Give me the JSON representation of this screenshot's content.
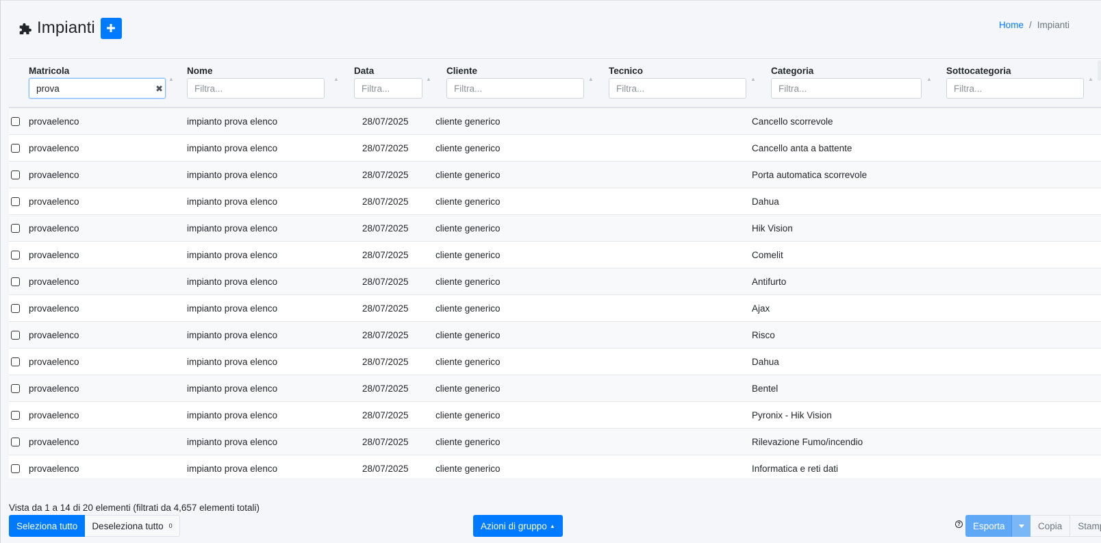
{
  "header": {
    "title": "Impianti",
    "breadcrumb": {
      "home": "Home",
      "separator": "/",
      "current": "Impianti"
    }
  },
  "table": {
    "columns": [
      {
        "key": "matricola",
        "label": "Matricola",
        "filter_value": "prova",
        "placeholder": "Filtra..."
      },
      {
        "key": "nome",
        "label": "Nome",
        "filter_value": "",
        "placeholder": "Filtra..."
      },
      {
        "key": "data",
        "label": "Data",
        "filter_value": "",
        "placeholder": "Filtra..."
      },
      {
        "key": "cliente",
        "label": "Cliente",
        "filter_value": "",
        "placeholder": "Filtra..."
      },
      {
        "key": "tecnico",
        "label": "Tecnico",
        "filter_value": "",
        "placeholder": "Filtra..."
      },
      {
        "key": "categoria",
        "label": "Categoria",
        "filter_value": "",
        "placeholder": "Filtra..."
      },
      {
        "key": "sottocategoria",
        "label": "Sottocategoria",
        "filter_value": "",
        "placeholder": "Filtra..."
      }
    ],
    "rows": [
      {
        "matricola": "provaelenco",
        "nome": "impianto prova elenco",
        "data": "28/07/2025",
        "cliente": "cliente generico",
        "tecnico": "",
        "categoria": "Cancello scorrevole",
        "sottocategoria": ""
      },
      {
        "matricola": "provaelenco",
        "nome": "impianto prova elenco",
        "data": "28/07/2025",
        "cliente": "cliente generico",
        "tecnico": "",
        "categoria": "Cancello anta a battente",
        "sottocategoria": ""
      },
      {
        "matricola": "provaelenco",
        "nome": "impianto prova elenco",
        "data": "28/07/2025",
        "cliente": "cliente generico",
        "tecnico": "",
        "categoria": "Porta automatica scorrevole",
        "sottocategoria": ""
      },
      {
        "matricola": "provaelenco",
        "nome": "impianto prova elenco",
        "data": "28/07/2025",
        "cliente": "cliente generico",
        "tecnico": "",
        "categoria": "Dahua",
        "sottocategoria": ""
      },
      {
        "matricola": "provaelenco",
        "nome": "impianto prova elenco",
        "data": "28/07/2025",
        "cliente": "cliente generico",
        "tecnico": "",
        "categoria": "Hik Vision",
        "sottocategoria": ""
      },
      {
        "matricola": "provaelenco",
        "nome": "impianto prova elenco",
        "data": "28/07/2025",
        "cliente": "cliente generico",
        "tecnico": "",
        "categoria": "Comelit",
        "sottocategoria": ""
      },
      {
        "matricola": "provaelenco",
        "nome": "impianto prova elenco",
        "data": "28/07/2025",
        "cliente": "cliente generico",
        "tecnico": "",
        "categoria": "Antifurto",
        "sottocategoria": ""
      },
      {
        "matricola": "provaelenco",
        "nome": "impianto prova elenco",
        "data": "28/07/2025",
        "cliente": "cliente generico",
        "tecnico": "",
        "categoria": "Ajax",
        "sottocategoria": ""
      },
      {
        "matricola": "provaelenco",
        "nome": "impianto prova elenco",
        "data": "28/07/2025",
        "cliente": "cliente generico",
        "tecnico": "",
        "categoria": "Risco",
        "sottocategoria": ""
      },
      {
        "matricola": "provaelenco",
        "nome": "impianto prova elenco",
        "data": "28/07/2025",
        "cliente": "cliente generico",
        "tecnico": "",
        "categoria": "Dahua",
        "sottocategoria": ""
      },
      {
        "matricola": "provaelenco",
        "nome": "impianto prova elenco",
        "data": "28/07/2025",
        "cliente": "cliente generico",
        "tecnico": "",
        "categoria": "Bentel",
        "sottocategoria": ""
      },
      {
        "matricola": "provaelenco",
        "nome": "impianto prova elenco",
        "data": "28/07/2025",
        "cliente": "cliente generico",
        "tecnico": "",
        "categoria": "Pyronix - Hik Vision",
        "sottocategoria": ""
      },
      {
        "matricola": "provaelenco",
        "nome": "impianto prova elenco",
        "data": "28/07/2025",
        "cliente": "cliente generico",
        "tecnico": "",
        "categoria": "Rilevazione Fumo/incendio",
        "sottocategoria": ""
      },
      {
        "matricola": "provaelenco",
        "nome": "impianto prova elenco",
        "data": "28/07/2025",
        "cliente": "cliente generico",
        "tecnico": "",
        "categoria": "Informatica e reti dati",
        "sottocategoria": ""
      }
    ]
  },
  "footer": {
    "info": "Vista da 1 a 14 di 20 elementi (filtrati da 4,657 elementi totali)",
    "select_all": "Seleziona tutto",
    "deselect_all": "Deseleziona tutto",
    "selected_count": "0",
    "group_actions": "Azioni di gruppo",
    "help": "?",
    "export": "Esporta",
    "copy": "Copia",
    "print": "Stampa"
  },
  "colors": {
    "primary": "#007bff",
    "export_button": "#5fa8f5",
    "background": "#f4f6f9"
  },
  "icons": {
    "title_icon": "puzzle-piece-icon",
    "add": "plus-icon",
    "clear": "times-icon",
    "sort": "sort-icon",
    "help": "question-circle-icon",
    "dropdown": "caret-down-icon"
  }
}
